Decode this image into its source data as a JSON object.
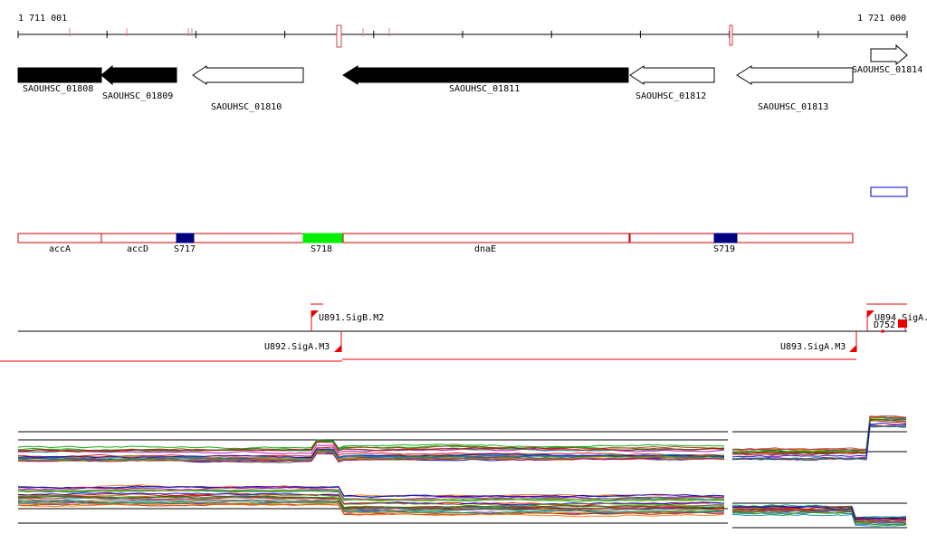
{
  "axis": {
    "start_label": "1 711 001",
    "end_label": "1 721 000"
  },
  "genes": [
    {
      "label": "SAOUHSC_01808",
      "strand": "+",
      "fill": "black"
    },
    {
      "label": "SAOUHSC_01809",
      "strand": "-",
      "fill": "black"
    },
    {
      "label": "SAOUHSC_01810",
      "strand": "-",
      "fill": "white"
    },
    {
      "label": "SAOUHSC_01811",
      "strand": "-",
      "fill": "black"
    },
    {
      "label": "SAOUHSC_01812",
      "strand": "-",
      "fill": "white"
    },
    {
      "label": "SAOUHSC_01813",
      "strand": "-",
      "fill": "white"
    },
    {
      "label": "SAOUHSC_01814",
      "strand": "+",
      "fill": "white"
    }
  ],
  "features": [
    {
      "label": "accA",
      "kind": "region"
    },
    {
      "label": "accD",
      "kind": "region"
    },
    {
      "label": "S717",
      "kind": "segment"
    },
    {
      "label": "S718",
      "kind": "segment"
    },
    {
      "label": "dnaE",
      "kind": "region"
    },
    {
      "label": "S719",
      "kind": "segment"
    }
  ],
  "promoters": [
    {
      "label": "U891.SigB.M2",
      "strand": "+"
    },
    {
      "label": "U892.SigA.M3",
      "strand": "-"
    },
    {
      "label": "U893.SigA.M3",
      "strand": "-"
    },
    {
      "label": "U894.SigA.",
      "strand": "+"
    },
    {
      "label": "D752",
      "strand": "+"
    }
  ],
  "colors": {
    "gene_stroke": "#000000",
    "feature_stroke": "#cc0000",
    "segment_dark": "#000080",
    "segment_bright": "#00ee00",
    "promoter": "#ee0000",
    "tick_mark": "#e08080",
    "unlabeled_box": "#0000cc"
  }
}
